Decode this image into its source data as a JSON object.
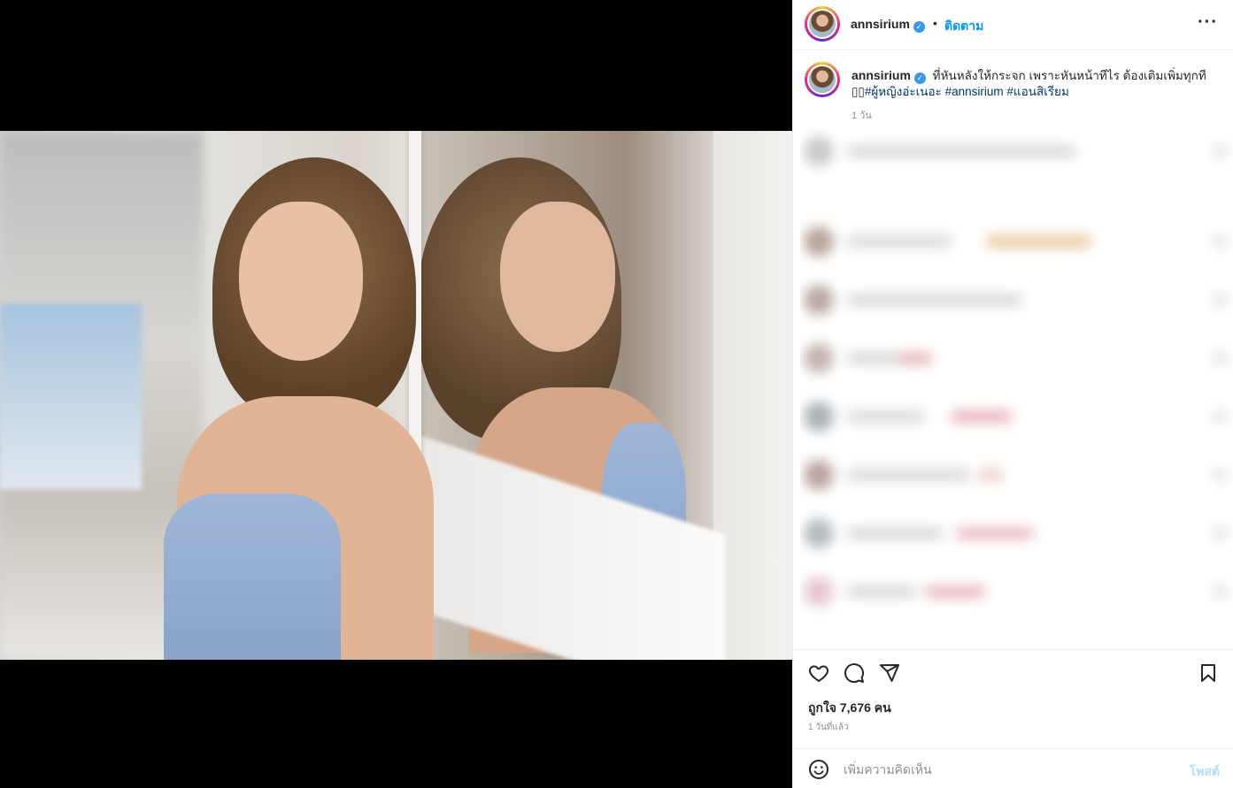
{
  "post": {
    "username": "annsirium",
    "verified_mark": "✓",
    "separator": "•",
    "follow_label": "ติดตาม",
    "more_label": "···"
  },
  "caption": {
    "username": "annsirium",
    "text": "ที่หันหลังให้กระจก เพราะหันหน้าทีไร ต้องเติมเพิ่มทุกที ",
    "emoji_boxes": "▯▯",
    "tags": [
      "#ผู้หญิงอ่ะเนอะ",
      "#annsirium",
      "#แอนสิเรียม"
    ],
    "time": "1 วัน"
  },
  "engagement": {
    "likes": "ถูกใจ 7,676 คน",
    "posted_ago": "1 วันที่แล้ว"
  },
  "comment_input": {
    "placeholder": "เพิ่มความคิดเห็น",
    "post_label": "โพสต์"
  },
  "icons": {
    "like": "heart-icon",
    "comment": "comment-icon",
    "share": "paper-plane-icon",
    "save": "bookmark-icon",
    "emoji": "smiley-icon"
  },
  "colors": {
    "link": "#0095f6",
    "hashtag": "#00376b",
    "muted": "#8e8e8e",
    "post_disabled": "#b2dffc"
  }
}
